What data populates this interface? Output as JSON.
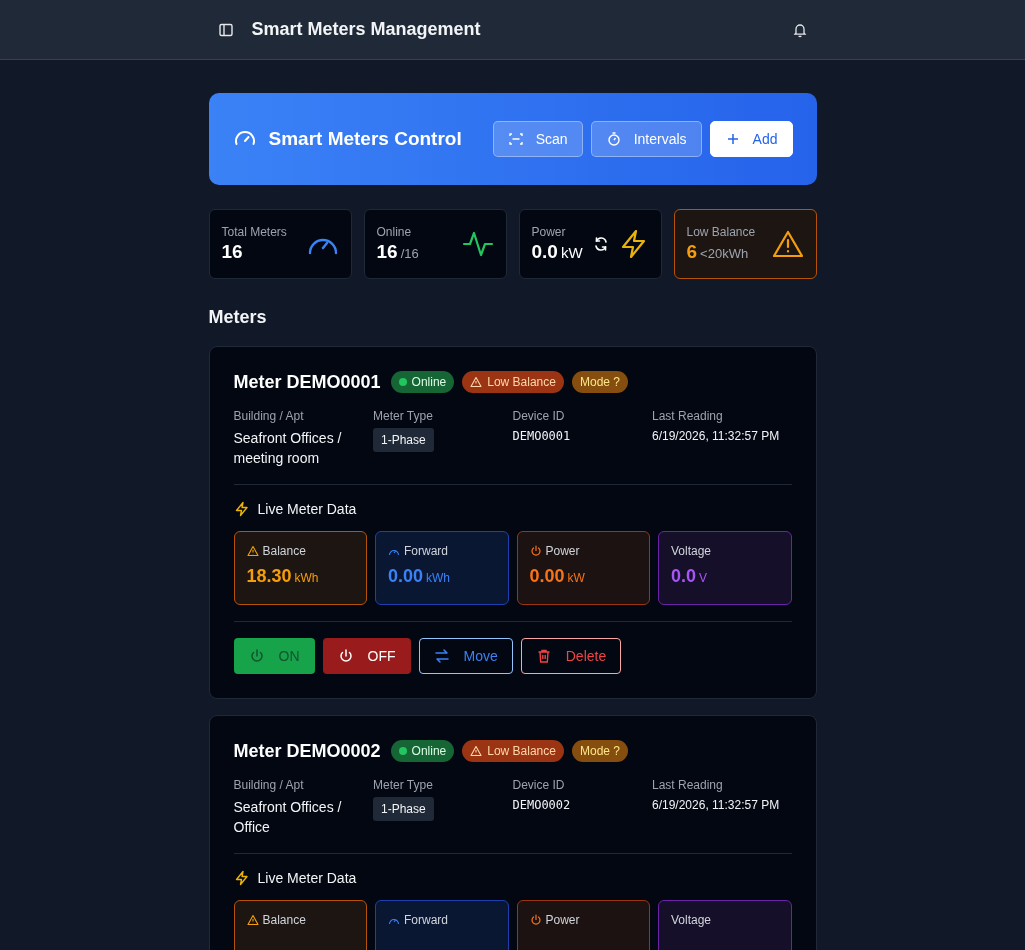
{
  "header": {
    "title": "Smart Meters Management"
  },
  "hero": {
    "title": "Smart Meters Control",
    "buttons": [
      {
        "label": "Scan",
        "kind": "scan"
      },
      {
        "label": "Intervals",
        "kind": "intervals"
      },
      {
        "label": "Add",
        "kind": "add"
      }
    ]
  },
  "stats": [
    {
      "kind": "total",
      "label": "Total Meters",
      "value": "16"
    },
    {
      "kind": "online",
      "label": "Online",
      "value": "16",
      "suffix": "/16"
    },
    {
      "kind": "power",
      "label": "Power",
      "value": "0.0",
      "suffix": "kW"
    },
    {
      "kind": "low_balance",
      "label": "Low Balance",
      "value": "6",
      "suffix": "<20kWh"
    }
  ],
  "section_title": "Meters",
  "meters": [
    {
      "title": "Meter DEMO0001",
      "badges": [
        {
          "kind": "online",
          "label": "Online"
        },
        {
          "kind": "warning",
          "label": "Low Balance"
        },
        {
          "kind": "mode",
          "label": "Mode ?"
        }
      ],
      "fields": [
        {
          "label": "Building / Apt",
          "value": "Seafront Offices / meeting room",
          "kind": "text"
        },
        {
          "label": "Meter Type",
          "value": "1-Phase",
          "kind": "tag"
        },
        {
          "label": "Device ID",
          "value": "DEMO0001",
          "kind": "mono"
        },
        {
          "label": "Last Reading",
          "value": "6/19/2026, 11:32:57 PM",
          "kind": "small"
        }
      ],
      "live_title": "Live Meter Data",
      "readings": [
        {
          "kind": "balance",
          "label": "Balance",
          "value": "18.30",
          "unit": "kWh"
        },
        {
          "kind": "forward",
          "label": "Forward",
          "value": "0.00",
          "unit": "kWh"
        },
        {
          "kind": "power",
          "label": "Power",
          "value": "0.00",
          "unit": "kW"
        },
        {
          "kind": "voltage",
          "label": "Voltage",
          "value": "0.0",
          "unit": "V"
        }
      ],
      "actions": [
        {
          "kind": "on",
          "label": "ON"
        },
        {
          "kind": "off",
          "label": "OFF"
        },
        {
          "kind": "move",
          "label": "Move"
        },
        {
          "kind": "delete",
          "label": "Delete"
        }
      ]
    },
    {
      "title": "Meter DEMO0002",
      "badges": [
        {
          "kind": "online",
          "label": "Online"
        },
        {
          "kind": "warning",
          "label": "Low Balance"
        },
        {
          "kind": "mode",
          "label": "Mode ?"
        }
      ],
      "fields": [
        {
          "label": "Building / Apt",
          "value": "Seafront Offices / Office",
          "kind": "text"
        },
        {
          "label": "Meter Type",
          "value": "1-Phase",
          "kind": "tag"
        },
        {
          "label": "Device ID",
          "value": "DEMO0002",
          "kind": "mono"
        },
        {
          "label": "Last Reading",
          "value": "6/19/2026, 11:32:57 PM",
          "kind": "small"
        }
      ],
      "live_title": "Live Meter Data",
      "readings": [
        {
          "kind": "balance",
          "label": "Balance"
        },
        {
          "kind": "forward",
          "label": "Forward"
        },
        {
          "kind": "power",
          "label": "Power"
        },
        {
          "kind": "voltage",
          "label": "Voltage"
        }
      ]
    }
  ]
}
